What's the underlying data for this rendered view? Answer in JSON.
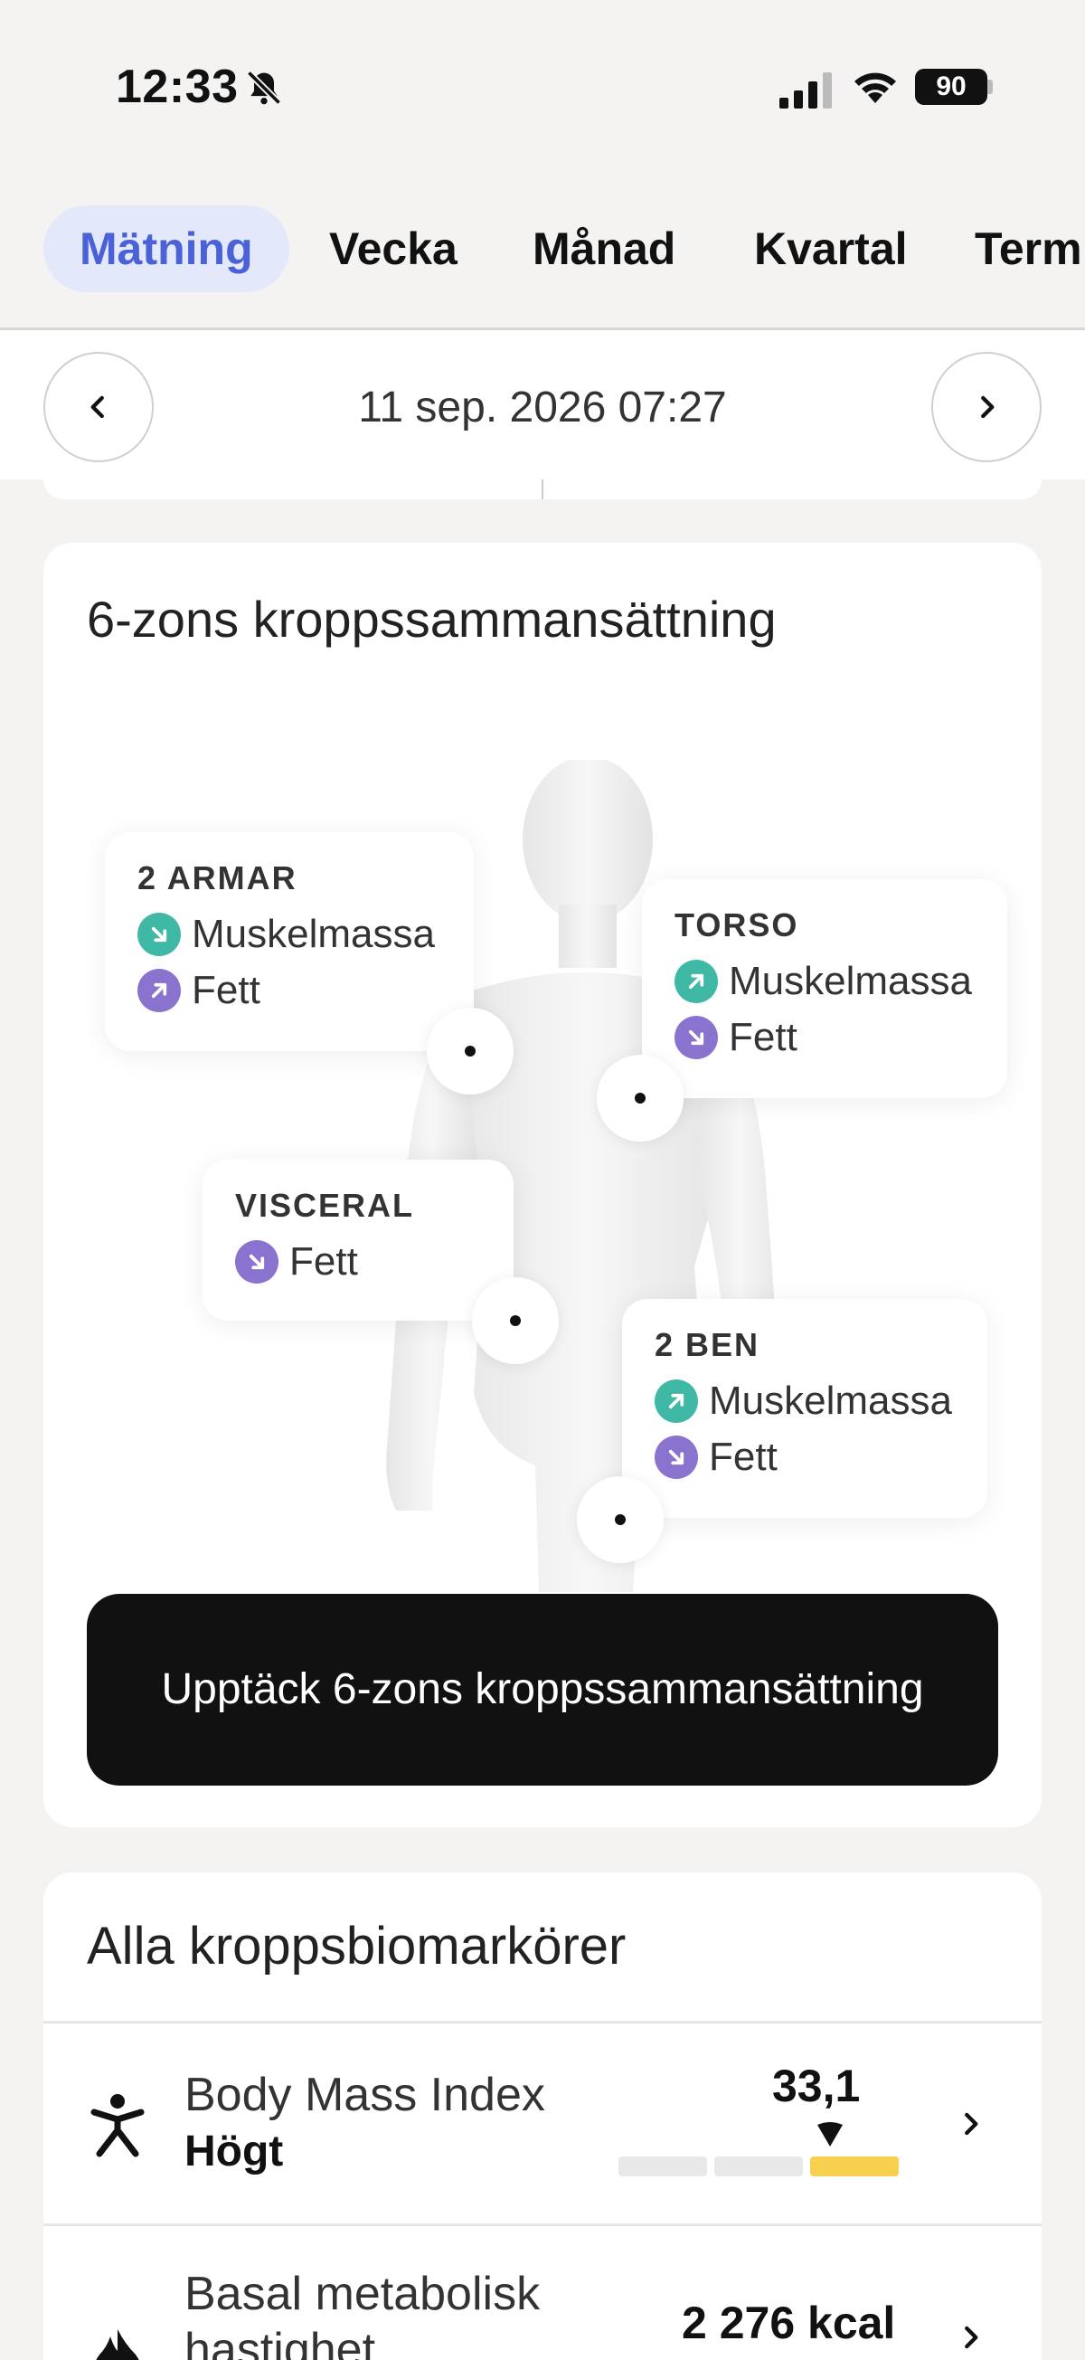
{
  "status_bar": {
    "time": "12:33",
    "battery": "90",
    "icons": [
      "bell-slash-icon",
      "signal-icon",
      "wifi-icon",
      "battery-icon"
    ]
  },
  "tabs": [
    {
      "label": "Mätning",
      "active": true
    },
    {
      "label": "Vecka",
      "active": false
    },
    {
      "label": "Månad",
      "active": false
    },
    {
      "label": "Kvartal",
      "active": false
    },
    {
      "label": "Term",
      "active": false
    }
  ],
  "date_nav": {
    "date": "11 sep. 2026 07:27",
    "prev_icon": "chevron-left-icon",
    "next_icon": "chevron-right-icon"
  },
  "zone_card": {
    "title": "6-zons kroppssammansättning",
    "zones": {
      "arms": {
        "name": "2 ARMAR",
        "rows": [
          {
            "label": "Muskelmassa",
            "trend": "down",
            "color": "#3fb8a6"
          },
          {
            "label": "Fett",
            "trend": "up",
            "color": "#8a72cf"
          }
        ]
      },
      "torso": {
        "name": "TORSO",
        "rows": [
          {
            "label": "Muskelmassa",
            "trend": "up",
            "color": "#3fb8a6"
          },
          {
            "label": "Fett",
            "trend": "down",
            "color": "#8a72cf"
          }
        ]
      },
      "visceral": {
        "name": "VISCERAL",
        "rows": [
          {
            "label": "Fett",
            "trend": "down",
            "color": "#8a72cf"
          }
        ]
      },
      "legs": {
        "name": "2 BEN",
        "rows": [
          {
            "label": "Muskelmassa",
            "trend": "up",
            "color": "#3fb8a6"
          },
          {
            "label": "Fett",
            "trend": "down",
            "color": "#8a72cf"
          }
        ]
      }
    },
    "button": "Upptäck 6-zons kroppssammansättning"
  },
  "biomarkers": {
    "title": "Alla kroppsbiomarkörer",
    "items": [
      {
        "name": "Body Mass Index",
        "status": "Högt",
        "value": "33,1",
        "icon": "person-icon",
        "range_segments": 3,
        "active_segment": 3,
        "active_color": "#f8cf4e"
      },
      {
        "name": "Basal metabolisk hastighet",
        "value": "2 276 kcal",
        "icon": "flame-icon"
      }
    ]
  },
  "colors": {
    "accent": "#4b62d6",
    "tab_active_bg": "#e3e8fa",
    "muscle": "#3fb8a6",
    "fat": "#8a72cf",
    "bmi_high": "#f8cf4e",
    "button_bg": "#111111"
  }
}
